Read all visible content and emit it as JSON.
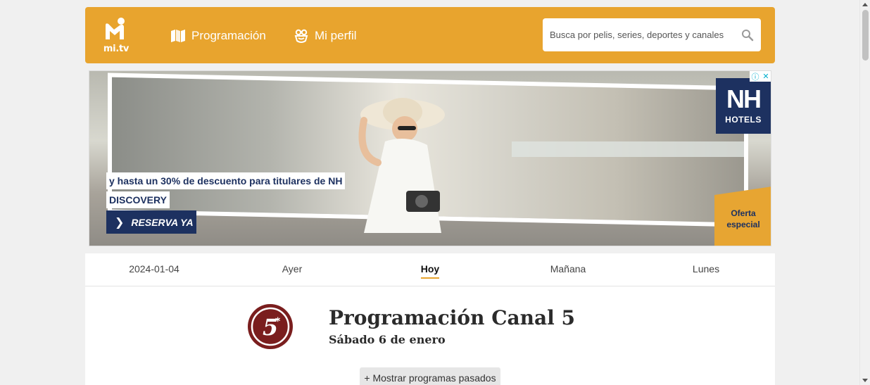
{
  "header": {
    "logo_text": "mi.tv",
    "nav": [
      {
        "label": "Programación",
        "icon": "map-icon"
      },
      {
        "label": "Mi perfil",
        "icon": "face-icon"
      }
    ],
    "search": {
      "placeholder": "Busca por pelis, series, deportes y canales",
      "value": ""
    }
  },
  "ad": {
    "line1": "y hasta un 30% de descuento para titulares de NH",
    "line2": "DISCOVERY",
    "cta": "RESERVA YA",
    "brand_big": "NH",
    "brand_small": "HOTELS",
    "offer_line1": "Oferta",
    "offer_line2": "especial"
  },
  "days": [
    {
      "label": "2024-01-04",
      "active": false
    },
    {
      "label": "Ayer",
      "active": false
    },
    {
      "label": "Hoy",
      "active": true
    },
    {
      "label": "Mañana",
      "active": false
    },
    {
      "label": "Lunes",
      "active": false
    }
  ],
  "channel": {
    "title": "Programación Canal 5",
    "date": "Sábado 6 de enero",
    "show_past": "+ Mostrar programas pasados"
  },
  "colors": {
    "brand": "#e8a42e",
    "nh_blue": "#1d3160",
    "channel_red": "#7a1e1e"
  }
}
